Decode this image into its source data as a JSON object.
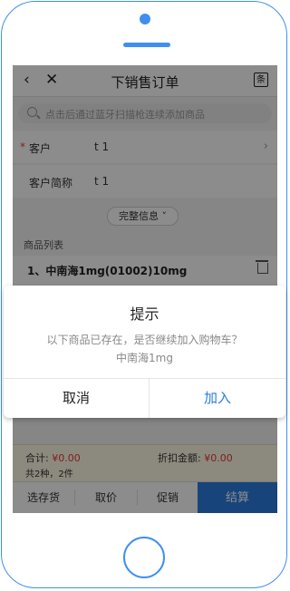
{
  "navbar": {
    "title": "下销售订单",
    "back_icon": "‹",
    "close_icon": "✕",
    "barcode_label": "条"
  },
  "search": {
    "placeholder": "点击后通过蓝牙扫描枪连续添加商品"
  },
  "customer": {
    "label": "客户",
    "value": "t 1",
    "required_mark": "*"
  },
  "customer_short": {
    "label": "客户简称",
    "value": "t 1"
  },
  "more_info_label": "完整信息 ˅",
  "product_list": {
    "title": "商品列表",
    "items": [
      {
        "name": "1、中南海1mg(01002)10mg"
      }
    ]
  },
  "totals": {
    "total_label": "合计:",
    "total_value": "¥0.00",
    "discount_label": "折扣金额:",
    "discount_value": "¥0.00",
    "count_text": "共2种，2件"
  },
  "tabs": [
    {
      "label": "选存货"
    },
    {
      "label": "取价"
    },
    {
      "label": "促销"
    }
  ],
  "checkout_label": "结算",
  "dialog": {
    "title": "提示",
    "message": "以下商品已存在，是否继续加入购物车？",
    "item": "中南海1mg",
    "cancel_label": "取消",
    "confirm_label": "加入"
  },
  "colors": {
    "accent": "#2a7de1",
    "phone_outline": "#3f8ff0",
    "price_red": "#e53935"
  }
}
